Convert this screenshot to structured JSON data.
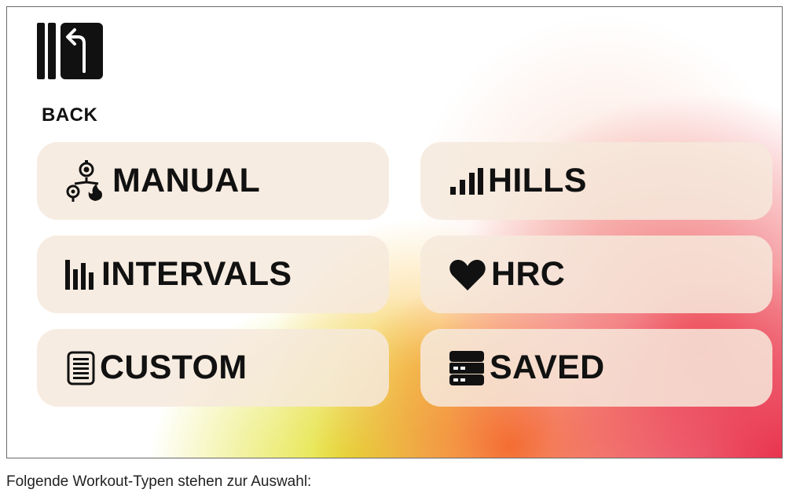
{
  "back": {
    "label": "BACK",
    "icon": "back-arrow-icon"
  },
  "tiles": {
    "manual": {
      "label": "MANUAL",
      "icon": "manual-icon"
    },
    "hills": {
      "label": "HILLS",
      "icon": "bars-ascending-icon"
    },
    "intervals": {
      "label": "INTERVALS",
      "icon": "interval-bars-icon"
    },
    "hrc": {
      "label": "HRC",
      "icon": "heart-icon"
    },
    "custom": {
      "label": "CUSTOM",
      "icon": "document-icon"
    },
    "saved": {
      "label": "SAVED",
      "icon": "stack-icon"
    }
  },
  "caption": "Folgende Workout-Typen stehen zur Auswahl:",
  "colors": {
    "tile_bg": "#f6e9dc",
    "text": "#111111",
    "gradient_red": "#e61e3c",
    "gradient_orange": "#f56e28",
    "gradient_yellow": "#e1e128"
  }
}
